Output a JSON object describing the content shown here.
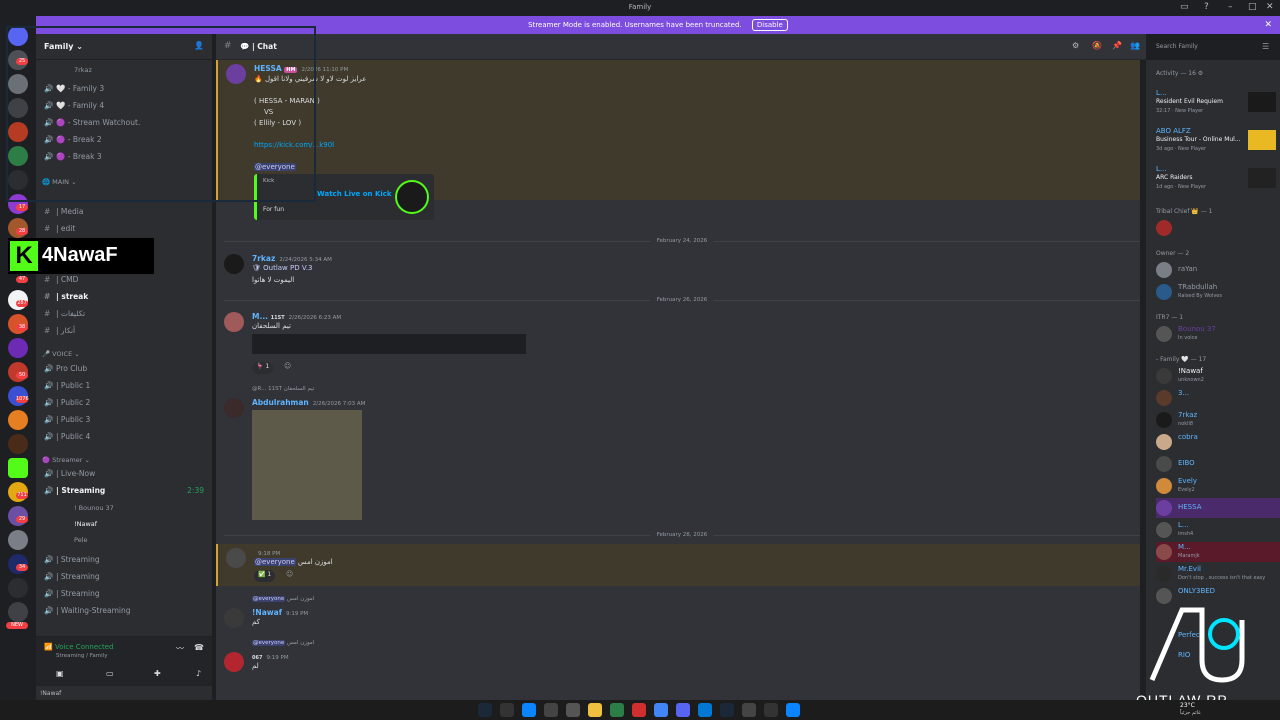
{
  "window": {
    "title": "Family"
  },
  "banner": {
    "text": "Streamer Mode is enabled. Usernames have been truncated.",
    "button": "Disable"
  },
  "rail": {
    "badges": [
      "25",
      "17",
      "28",
      "47",
      "287",
      "38",
      "50",
      "1076",
      "711",
      "29",
      "34",
      "NEW"
    ]
  },
  "sidebar": {
    "guild_name": "Family",
    "channels_top": [
      {
        "icon": "user",
        "label": "7rkaz",
        "sub": true
      },
      {
        "icon": "voice",
        "label": "🤍 - Family 3"
      },
      {
        "icon": "voice",
        "label": "🤍 - Family 4"
      },
      {
        "icon": "voice",
        "label": "🟣 - Stream Watchout."
      },
      {
        "icon": "voice",
        "label": "🟣 - Break 2"
      },
      {
        "icon": "voice",
        "label": "🟣 - Break 3"
      }
    ],
    "cat_main": "MAIN",
    "channels_main": [
      {
        "icon": "#",
        "label": "| Media"
      },
      {
        "icon": "#",
        "label": "| edit"
      },
      {
        "icon": "#",
        "label": "| CMD"
      },
      {
        "icon": "#",
        "label": "| streak",
        "bold": true
      },
      {
        "icon": "#",
        "label": "| تكليفات"
      },
      {
        "icon": "#",
        "label": "| أنكار"
      }
    ],
    "cat_voice": "VOICE",
    "channels_voice": [
      {
        "icon": "voice",
        "label": "Pro Club"
      },
      {
        "icon": "voice",
        "label": "| Public 1"
      },
      {
        "icon": "voice",
        "label": "| Public 2"
      },
      {
        "icon": "voice",
        "label": "| Public 3"
      },
      {
        "icon": "voice",
        "label": "| Public 4"
      }
    ],
    "cat_streamer": "Streamer",
    "channels_streamer": [
      {
        "icon": "voice",
        "label": "| Live-Now"
      },
      {
        "icon": "voice",
        "label": "| Streaming",
        "bold": true,
        "time": "2:39"
      }
    ],
    "stream_users": [
      "! Bounou 37",
      "!Nawaf",
      "Pele"
    ],
    "channels_streamer2": [
      {
        "icon": "voice",
        "label": "| Streaming"
      },
      {
        "icon": "voice",
        "label": "| Streaming"
      },
      {
        "icon": "voice",
        "label": "| Streaming"
      },
      {
        "icon": "voice",
        "label": "| Waiting-Streaming"
      }
    ],
    "voice_connected": "Voice Connected",
    "voice_channel": "Streaming / Family",
    "user": "!Nawaf"
  },
  "chat": {
    "channel": "| Chat",
    "messages": [
      {
        "author": "HESSA",
        "tag": "HM",
        "time": "2/2026 11:10 PM",
        "color": "#5fb5ff",
        "lines": [
          "عرايز لوت لاو لا شرفيني ولانا اقول",
          "( HESSA - MARAN )",
          "VS",
          "( Ellily - LOV )",
          "https://kick.com/...k90l",
          "@everyone"
        ],
        "embed_site": "Kick",
        "embed_title": "Watch Live on Kick",
        "embed_desc": "For fun"
      }
    ],
    "date1": "February 24, 2026",
    "msg2": {
      "author": "7rkaz",
      "time": "2/24/2026 5:34 AM",
      "role": "Outlaw PD V.3",
      "text": "اليموت لا هاتوا"
    },
    "date2": "February 26, 2026",
    "msg3": {
      "author": "M...",
      "tag": "11ST",
      "time": "2/26/2026 6:23 AM",
      "text": "تيم السلحفان",
      "reaction": "1"
    },
    "msg4": {
      "reply": "@R... 11ST تيم السلحفان",
      "author": "Abdulrahman",
      "time": "2/26/2026 7:03 AM"
    },
    "date3": "February 28, 2026",
    "msg5": {
      "time": "9:18 PM",
      "mention": "@everyone",
      "text": "اموزن امس",
      "reaction": "1"
    },
    "msg6": {
      "reply_mention": "@everyone",
      "reply_text": "اموزن امس",
      "author": "!Nawaf",
      "time": "9:19 PM",
      "text": "كم"
    },
    "msg7": {
      "reply_mention": "@everyone",
      "reply_text": "اموزن امس",
      "author": "",
      "tag": "067",
      "time": "9:19 PM",
      "text": "لم"
    }
  },
  "members": {
    "search_placeholder": "Search Family",
    "activity_header": "Activity — 16",
    "activities": [
      {
        "name": "L...",
        "game": "Resident Evil Requiem",
        "meta": "32:17 · New Player"
      },
      {
        "name": "ABO ALFZ",
        "game": "Business Tour - Online Mul...",
        "meta": "3d ago · New Player"
      },
      {
        "name": "L...",
        "game": "ARC Raiders",
        "meta": "1d ago · New Player"
      }
    ],
    "group1": "Tribal Chief 👑 — 1",
    "group2": "Owner — 2",
    "owners": [
      {
        "name": "raYan",
        "status": ""
      },
      {
        "name": "TRabdullah",
        "status": "Raised By Wolves"
      }
    ],
    "group3": "ITR7 — 1",
    "itr7": {
      "name": "Bounou 37",
      "status": "In voice"
    },
    "group4": "- Family 🤍 — 17",
    "family": [
      {
        "name": "!Nawaf",
        "status": "unknown2",
        "color": "#f2f3f5"
      },
      {
        "name": "3...",
        "status": "",
        "color": "#5fb5ff"
      },
      {
        "name": "7rkaz",
        "status": "nokli8",
        "color": "#5fb5ff"
      },
      {
        "name": "cobra",
        "status": "",
        "color": "#5fb5ff"
      },
      {
        "name": "EIBO",
        "status": "",
        "color": "#5fb5ff"
      },
      {
        "name": "Evely",
        "status": "Evely2",
        "color": "#5fb5ff"
      },
      {
        "name": "HESSA",
        "status": "",
        "color": "#5fb5ff"
      },
      {
        "name": "L...",
        "status": "imsh4",
        "color": "#5fb5ff"
      },
      {
        "name": "M...",
        "status": "Maramjk",
        "color": "#5fb5ff"
      },
      {
        "name": "Mr.Evil",
        "status": "Don't stop , success isn't that easy",
        "color": "#5fb5ff"
      },
      {
        "name": "ONLY3BED",
        "status": "",
        "color": "#5fb5ff"
      },
      {
        "name": "Perfect",
        "status": "",
        "color": "#5fb5ff"
      },
      {
        "name": "RIO",
        "status": "",
        "color": "#5fb5ff"
      }
    ]
  },
  "overlays": {
    "stream_name": "4NawaF",
    "kick_letter": "K",
    "outlaw_label": "OUTLAW RP"
  },
  "taskbar": {
    "clock": "23°C",
    "weather": "غائم جزئياً"
  }
}
